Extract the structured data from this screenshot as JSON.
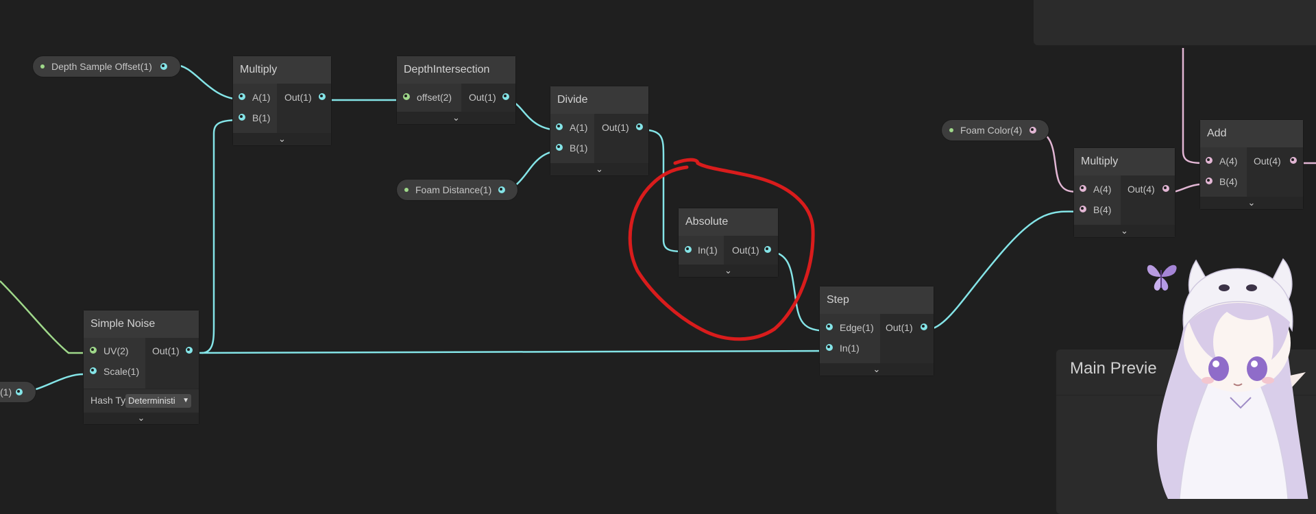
{
  "properties": {
    "depth_sample_offset": "Depth Sample Offset(1)",
    "foam_distance": "Foam Distance(1)",
    "foam_color": "Foam Color(4)",
    "left_partial": "(1)"
  },
  "nodes": {
    "multiply1": {
      "title": "Multiply",
      "in_a": "A(1)",
      "in_b": "B(1)",
      "out": "Out(1)"
    },
    "depth_intersection": {
      "title": "DepthIntersection",
      "in": "offset(2)",
      "out": "Out(1)"
    },
    "divide": {
      "title": "Divide",
      "in_a": "A(1)",
      "in_b": "B(1)",
      "out": "Out(1)"
    },
    "absolute": {
      "title": "Absolute",
      "in": "In(1)",
      "out": "Out(1)"
    },
    "step": {
      "title": "Step",
      "in_a": "Edge(1)",
      "in_b": "In(1)",
      "out": "Out(1)"
    },
    "simple_noise": {
      "title": "Simple Noise",
      "in_a": "UV(2)",
      "in_b": "Scale(1)",
      "out": "Out(1)",
      "hash_label": "Hash Ty",
      "hash_value": "Deterministi"
    },
    "multiply2": {
      "title": "Multiply",
      "in_a": "A(4)",
      "in_b": "B(4)",
      "out": "Out(4)"
    },
    "add": {
      "title": "Add",
      "in_a": "A(4)",
      "in_b": "B(4)",
      "out": "Out(4)"
    }
  },
  "main_preview": {
    "title": "Main Previe"
  },
  "icons": {
    "expand": "chevron-down-icon",
    "dropdown": "caret-down-icon"
  },
  "colors": {
    "float_wire": "#84e4e7",
    "vector2_wire": "#9fd88a",
    "vector4_wire": "#e2b6d4",
    "annotation": "#d91c1c"
  }
}
